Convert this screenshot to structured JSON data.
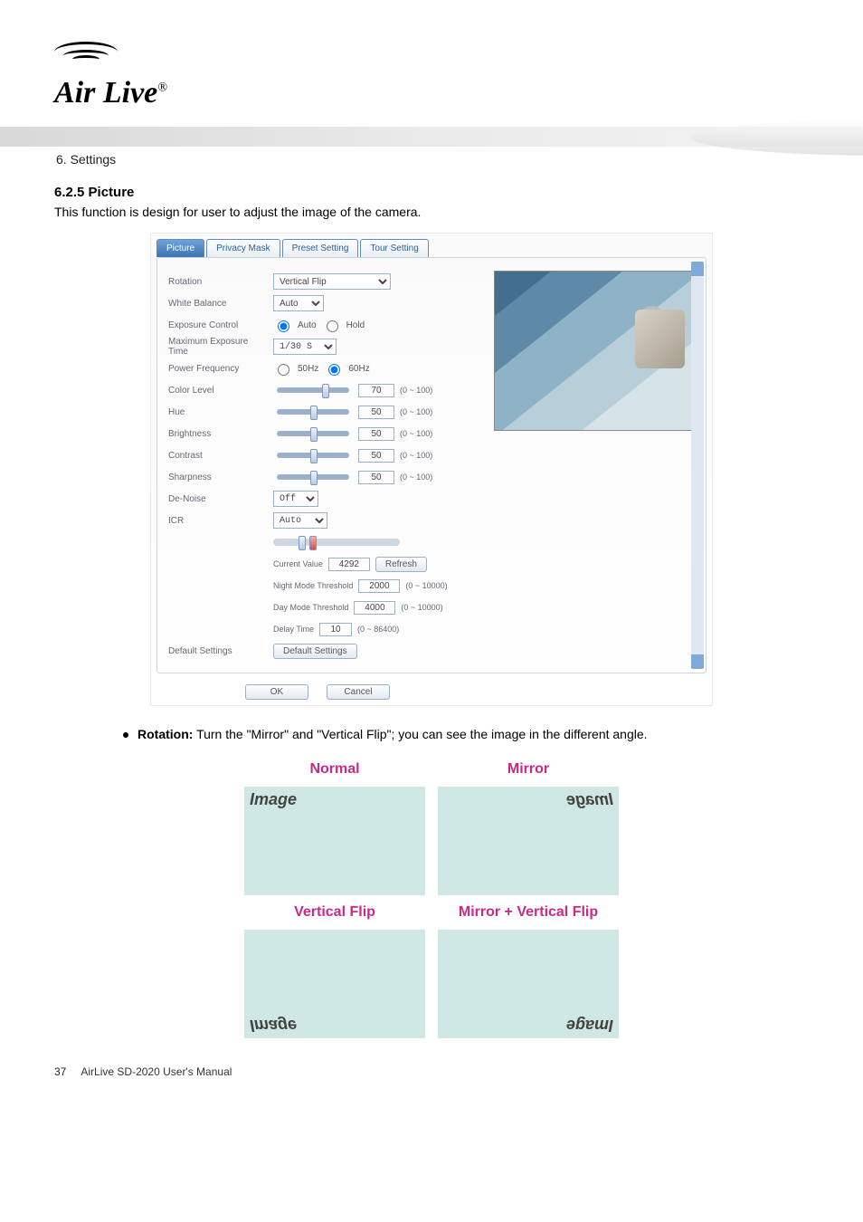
{
  "logo": {
    "text": "Air Live",
    "reg": "®"
  },
  "chapter": "6. Settings",
  "section_title": "6.2.5 Picture",
  "intro_text": "This function is design for user to adjust the image of the camera.",
  "screenshot": {
    "tabs": [
      "Picture",
      "Privacy Mask",
      "Preset Setting",
      "Tour Setting"
    ],
    "active_tab_index": 0,
    "rows": {
      "rotation": {
        "label": "Rotation",
        "value": "Vertical Flip"
      },
      "white_balance": {
        "label": "White Balance",
        "value": "Auto"
      },
      "exposure_control": {
        "label": "Exposure Control",
        "mode": "Auto",
        "options": [
          "Auto",
          "Hold"
        ]
      },
      "max_exposure": {
        "label": "Maximum Exposure Time",
        "value": "1/30 S"
      },
      "power_freq": {
        "label": "Power Frequency",
        "selected": "60Hz",
        "options": [
          "50Hz",
          "60Hz"
        ]
      },
      "color_level": {
        "label": "Color Level",
        "value": "70",
        "range": "(0 ~ 100)"
      },
      "hue": {
        "label": "Hue",
        "value": "50",
        "range": "(0 ~ 100)"
      },
      "brightness": {
        "label": "Brightness",
        "value": "50",
        "range": "(0 ~ 100)"
      },
      "contrast": {
        "label": "Contrast",
        "value": "50",
        "range": "(0 ~ 100)"
      },
      "sharpness": {
        "label": "Sharpness",
        "value": "50",
        "range": "(0 ~ 100)"
      },
      "de_noise": {
        "label": "De-Noise",
        "value": "Off"
      },
      "icr": {
        "label": "ICR",
        "value": "Auto",
        "current_value_label": "Current Value",
        "current_value": "4292",
        "refresh": "Refresh",
        "night_label": "Night Mode Threshold",
        "night_value": "2000",
        "night_range": "(0 ~ 10000)",
        "day_label": "Day Mode Threshold",
        "day_value": "4000",
        "day_range": "(0 ~ 10000)",
        "delay_label": "Delay Time",
        "delay_value": "10",
        "delay_range": "(0 ~ 86400)"
      },
      "defaults": {
        "label": "Default Settings",
        "button": "Default Settings"
      }
    },
    "footer": {
      "ok": "OK",
      "cancel": "Cancel"
    }
  },
  "bullet": {
    "heading": "Rotation:",
    "text": " Turn the \"Mirror\" and \"Vertical Flip\"; you can see the image in the different angle."
  },
  "rotation_diagram": {
    "titles": [
      "Normal",
      "Mirror",
      "Vertical Flip",
      "Mirror + Vertical Flip"
    ],
    "word": "Image"
  },
  "footer_page": {
    "num": "37",
    "text": "AirLive SD-2020 User's Manual"
  }
}
